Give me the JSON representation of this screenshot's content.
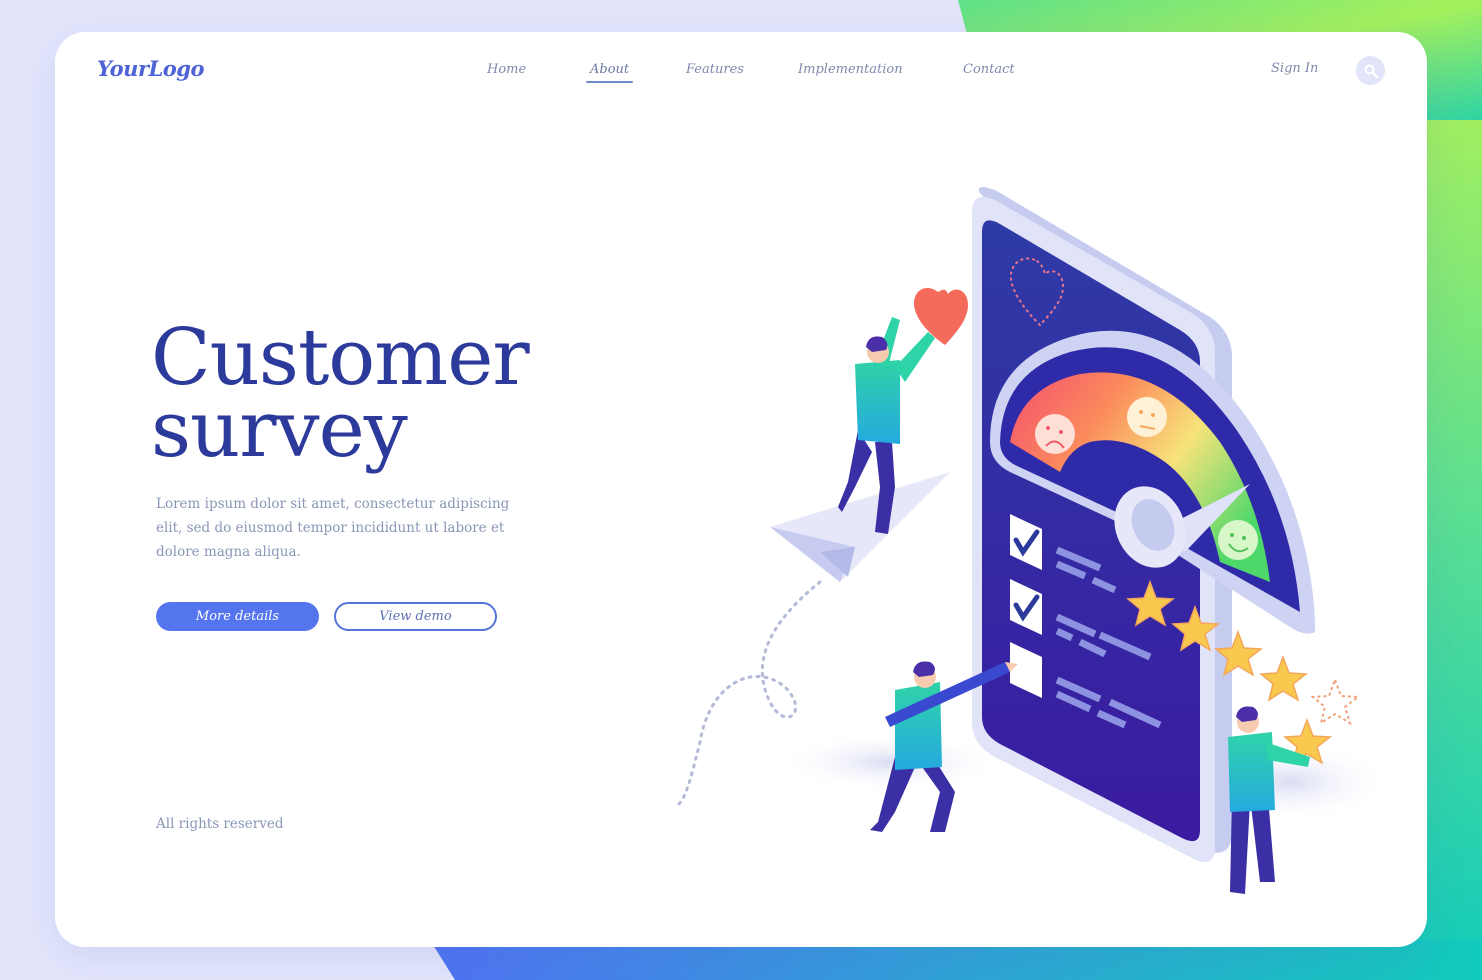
{
  "header": {
    "logo": "YourLogo",
    "nav": [
      {
        "label": "Home",
        "active": false
      },
      {
        "label": "About",
        "active": true
      },
      {
        "label": "Features",
        "active": false
      },
      {
        "label": "Implementation",
        "active": false
      },
      {
        "label": "Contact",
        "active": false
      }
    ],
    "sign_in": "Sign In",
    "search_icon": "search-icon"
  },
  "hero": {
    "title_line1": "Customer",
    "title_line2": "survey",
    "description": "Lorem ipsum dolor sit amet, consectetur adipiscing elit, sed do eiusmod tempor incididunt ut labore et dolore magna aliqua.",
    "primary_button": "More details",
    "secondary_button": "View demo"
  },
  "footer": {
    "text": "All rights reserved"
  },
  "illustration": {
    "subject": "Isometric smartphone with satisfaction gauge, checklist and star rating",
    "gauge_faces": [
      "sad-face-icon",
      "neutral-face-icon",
      "happy-face-icon"
    ],
    "checklist": [
      {
        "checked": true
      },
      {
        "checked": true
      },
      {
        "checked": false
      }
    ],
    "rating": {
      "filled_stars": 5,
      "outline_stars": 1
    },
    "colors": {
      "phone_screen": "#2f2aa8",
      "phone_frame": "#d8dcf6",
      "gauge_red": "#f25a6a",
      "gauge_yellow": "#f7e37a",
      "gauge_green": "#5ad66a",
      "star": "#f8c94e",
      "shirt": "#27c8b8",
      "pants": "#3a2fa5",
      "heart": "#f46b5b"
    }
  },
  "theme": {
    "accent": "#5575ee",
    "title": "#2b3a9b",
    "muted_text": "#8a96b8",
    "background": "#e3e6fb"
  }
}
